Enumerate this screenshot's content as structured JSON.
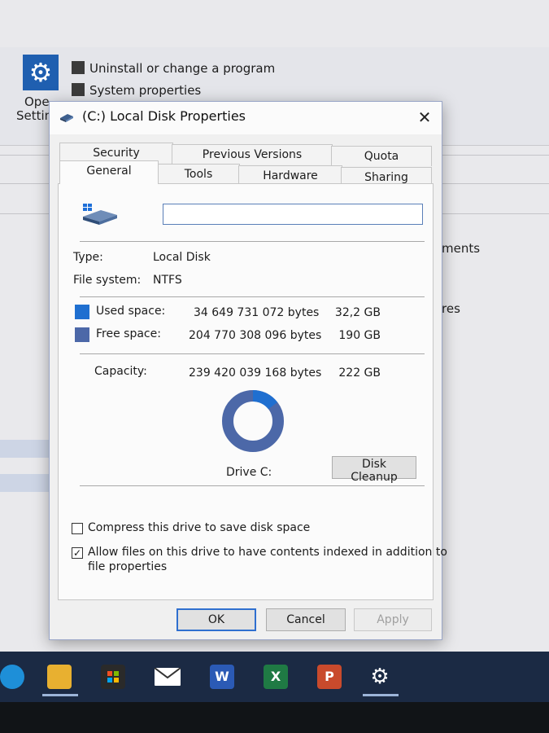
{
  "background": {
    "links": [
      "Uninstall or change a program",
      "System properties"
    ],
    "side_labels": [
      "Ope",
      "Settin"
    ],
    "right_fragments": [
      "ments",
      "res"
    ]
  },
  "dialog": {
    "title": "(C:) Local Disk Properties",
    "close_glyph": "✕",
    "tabs_row1": [
      "Security",
      "Previous Versions",
      "Quota"
    ],
    "tabs_row2": [
      "General",
      "Tools",
      "Hardware",
      "Sharing"
    ],
    "active_tab": "General",
    "volume_label_value": "",
    "type_label": "Type:",
    "type_value": "Local Disk",
    "fs_label": "File system:",
    "fs_value": "NTFS",
    "used_label": "Used space:",
    "used_bytes": "34 649 731 072 bytes",
    "used_gb": "32,2 GB",
    "free_label": "Free space:",
    "free_bytes": "204 770 308 096 bytes",
    "free_gb": "190 GB",
    "capacity_label": "Capacity:",
    "capacity_bytes": "239 420 039 168 bytes",
    "capacity_gb": "222 GB",
    "used_fraction": 0.145,
    "drive_label": "Drive C:",
    "cleanup_label": "Disk Cleanup",
    "compress_label": "Compress this drive to save disk space",
    "compress_checked": false,
    "index_label_line1": "Allow files on this drive to have contents indexed in addition to",
    "index_label_line2": "file properties",
    "index_checked": true,
    "ok_label": "OK",
    "cancel_label": "Cancel",
    "apply_label": "Apply"
  },
  "colors": {
    "used": "#1f6fd0",
    "free": "#4c68a8",
    "accent": "#2f6fcf"
  },
  "taskbar": {
    "icons": [
      "edge-icon",
      "file-explorer-icon",
      "store-icon",
      "mail-icon",
      "word-icon",
      "excel-icon",
      "powerpoint-icon",
      "settings-icon"
    ],
    "word_glyph": "W",
    "excel_glyph": "X",
    "powerpoint_glyph": "P",
    "settings_glyph": "⚙"
  }
}
